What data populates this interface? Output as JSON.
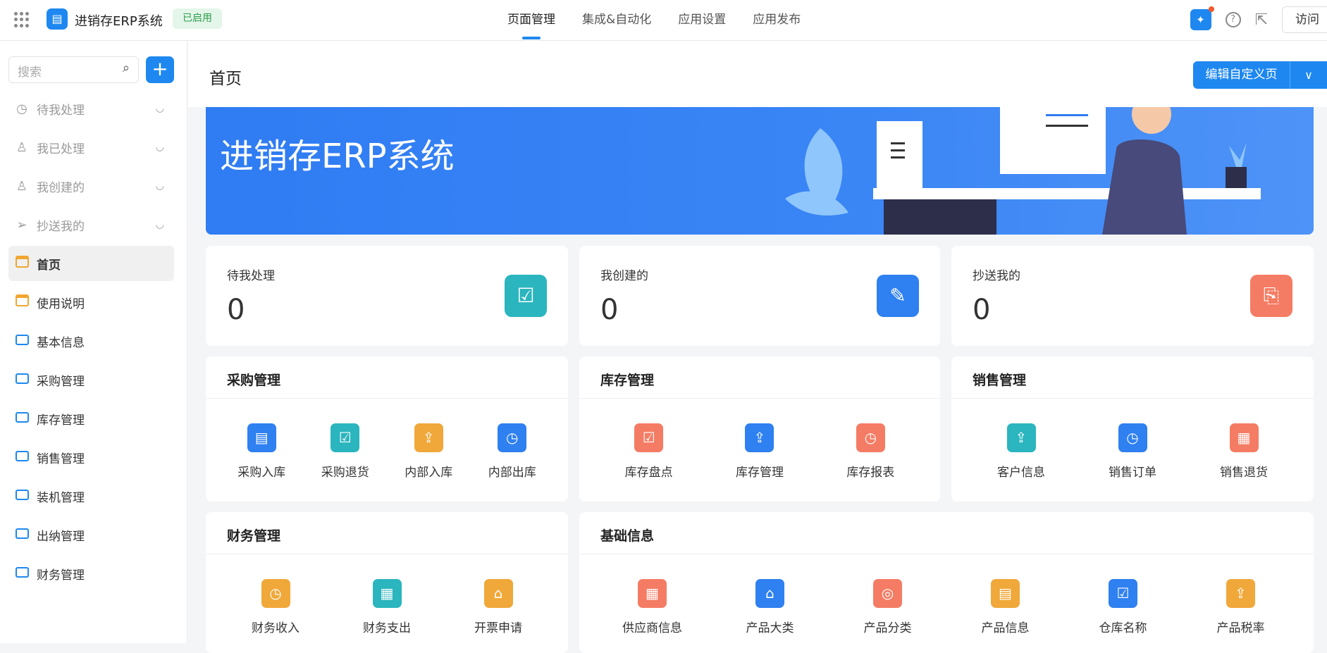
{
  "topbar": {
    "app_name": "进销存ERP系统",
    "status_badge": "已启用",
    "nav": [
      "页面管理",
      "集成&自动化",
      "应用设置",
      "应用发布"
    ],
    "visit_label": "访问"
  },
  "sidebar": {
    "search_placeholder": "搜索",
    "items": [
      {
        "label": "待我处理",
        "icon": "clock-icon"
      },
      {
        "label": "我已处理",
        "icon": "user-check-icon"
      },
      {
        "label": "我创建的",
        "icon": "user-icon"
      },
      {
        "label": "抄送我的",
        "icon": "send-icon"
      },
      {
        "label": "首页",
        "icon": "page-icon"
      },
      {
        "label": "使用说明",
        "icon": "page-icon"
      },
      {
        "label": "基本信息",
        "icon": "folder-icon"
      },
      {
        "label": "采购管理",
        "icon": "folder-icon"
      },
      {
        "label": "库存管理",
        "icon": "folder-icon"
      },
      {
        "label": "销售管理",
        "icon": "folder-icon"
      },
      {
        "label": "装机管理",
        "icon": "folder-icon"
      },
      {
        "label": "出纳管理",
        "icon": "folder-icon"
      },
      {
        "label": "财务管理",
        "icon": "folder-icon"
      }
    ]
  },
  "main": {
    "title": "首页",
    "edit_button": "编辑自定义页",
    "banner_title": "进销存ERP系统",
    "stats": [
      {
        "label": "待我处理",
        "value": "0",
        "color": "#2bb5be"
      },
      {
        "label": "我创建的",
        "value": "0",
        "color": "#2f80f0"
      },
      {
        "label": "抄送我的",
        "value": "0",
        "color": "#f57c64"
      }
    ],
    "modules": [
      {
        "title": "采购管理",
        "items": [
          {
            "label": "采购入库",
            "color": "#2f80f0"
          },
          {
            "label": "采购退货",
            "color": "#2bb5be"
          },
          {
            "label": "内部入库",
            "color": "#f0a83a"
          },
          {
            "label": "内部出库",
            "color": "#2f80f0"
          }
        ]
      },
      {
        "title": "库存管理",
        "items": [
          {
            "label": "库存盘点",
            "color": "#f57c64"
          },
          {
            "label": "库存管理",
            "color": "#2f80f0"
          },
          {
            "label": "库存报表",
            "color": "#f57c64"
          }
        ]
      },
      {
        "title": "销售管理",
        "items": [
          {
            "label": "客户信息",
            "color": "#2bb5be"
          },
          {
            "label": "销售订单",
            "color": "#2f80f0"
          },
          {
            "label": "销售退货",
            "color": "#f57c64"
          }
        ]
      },
      {
        "title": "财务管理",
        "items": [
          {
            "label": "财务收入",
            "color": "#f0a83a"
          },
          {
            "label": "财务支出",
            "color": "#2bb5be"
          },
          {
            "label": "开票申请",
            "color": "#f0a83a"
          }
        ]
      },
      {
        "title": "基础信息",
        "items": [
          {
            "label": "供应商信息",
            "color": "#f57c64"
          },
          {
            "label": "产品大类",
            "color": "#2f80f0"
          },
          {
            "label": "产品分类",
            "color": "#f57c64"
          },
          {
            "label": "产品信息",
            "color": "#f0a83a"
          },
          {
            "label": "仓库名称",
            "color": "#2f80f0"
          },
          {
            "label": "产品税率",
            "color": "#f0a83a"
          }
        ]
      }
    ]
  }
}
